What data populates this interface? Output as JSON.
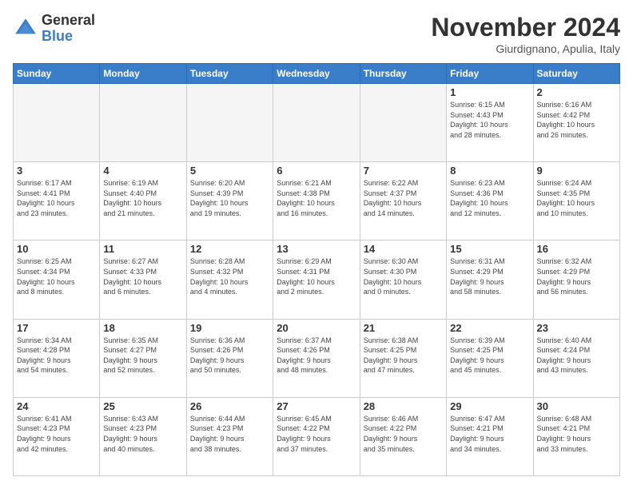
{
  "logo": {
    "general": "General",
    "blue": "Blue"
  },
  "header": {
    "month": "November 2024",
    "location": "Giurdignano, Apulia, Italy"
  },
  "weekdays": [
    "Sunday",
    "Monday",
    "Tuesday",
    "Wednesday",
    "Thursday",
    "Friday",
    "Saturday"
  ],
  "weeks": [
    [
      {
        "day": "",
        "info": ""
      },
      {
        "day": "",
        "info": ""
      },
      {
        "day": "",
        "info": ""
      },
      {
        "day": "",
        "info": ""
      },
      {
        "day": "",
        "info": ""
      },
      {
        "day": "1",
        "info": "Sunrise: 6:15 AM\nSunset: 4:43 PM\nDaylight: 10 hours\nand 28 minutes."
      },
      {
        "day": "2",
        "info": "Sunrise: 6:16 AM\nSunset: 4:42 PM\nDaylight: 10 hours\nand 26 minutes."
      }
    ],
    [
      {
        "day": "3",
        "info": "Sunrise: 6:17 AM\nSunset: 4:41 PM\nDaylight: 10 hours\nand 23 minutes."
      },
      {
        "day": "4",
        "info": "Sunrise: 6:19 AM\nSunset: 4:40 PM\nDaylight: 10 hours\nand 21 minutes."
      },
      {
        "day": "5",
        "info": "Sunrise: 6:20 AM\nSunset: 4:39 PM\nDaylight: 10 hours\nand 19 minutes."
      },
      {
        "day": "6",
        "info": "Sunrise: 6:21 AM\nSunset: 4:38 PM\nDaylight: 10 hours\nand 16 minutes."
      },
      {
        "day": "7",
        "info": "Sunrise: 6:22 AM\nSunset: 4:37 PM\nDaylight: 10 hours\nand 14 minutes."
      },
      {
        "day": "8",
        "info": "Sunrise: 6:23 AM\nSunset: 4:36 PM\nDaylight: 10 hours\nand 12 minutes."
      },
      {
        "day": "9",
        "info": "Sunrise: 6:24 AM\nSunset: 4:35 PM\nDaylight: 10 hours\nand 10 minutes."
      }
    ],
    [
      {
        "day": "10",
        "info": "Sunrise: 6:25 AM\nSunset: 4:34 PM\nDaylight: 10 hours\nand 8 minutes."
      },
      {
        "day": "11",
        "info": "Sunrise: 6:27 AM\nSunset: 4:33 PM\nDaylight: 10 hours\nand 6 minutes."
      },
      {
        "day": "12",
        "info": "Sunrise: 6:28 AM\nSunset: 4:32 PM\nDaylight: 10 hours\nand 4 minutes."
      },
      {
        "day": "13",
        "info": "Sunrise: 6:29 AM\nSunset: 4:31 PM\nDaylight: 10 hours\nand 2 minutes."
      },
      {
        "day": "14",
        "info": "Sunrise: 6:30 AM\nSunset: 4:30 PM\nDaylight: 10 hours\nand 0 minutes."
      },
      {
        "day": "15",
        "info": "Sunrise: 6:31 AM\nSunset: 4:29 PM\nDaylight: 9 hours\nand 58 minutes."
      },
      {
        "day": "16",
        "info": "Sunrise: 6:32 AM\nSunset: 4:29 PM\nDaylight: 9 hours\nand 56 minutes."
      }
    ],
    [
      {
        "day": "17",
        "info": "Sunrise: 6:34 AM\nSunset: 4:28 PM\nDaylight: 9 hours\nand 54 minutes."
      },
      {
        "day": "18",
        "info": "Sunrise: 6:35 AM\nSunset: 4:27 PM\nDaylight: 9 hours\nand 52 minutes."
      },
      {
        "day": "19",
        "info": "Sunrise: 6:36 AM\nSunset: 4:26 PM\nDaylight: 9 hours\nand 50 minutes."
      },
      {
        "day": "20",
        "info": "Sunrise: 6:37 AM\nSunset: 4:26 PM\nDaylight: 9 hours\nand 48 minutes."
      },
      {
        "day": "21",
        "info": "Sunrise: 6:38 AM\nSunset: 4:25 PM\nDaylight: 9 hours\nand 47 minutes."
      },
      {
        "day": "22",
        "info": "Sunrise: 6:39 AM\nSunset: 4:25 PM\nDaylight: 9 hours\nand 45 minutes."
      },
      {
        "day": "23",
        "info": "Sunrise: 6:40 AM\nSunset: 4:24 PM\nDaylight: 9 hours\nand 43 minutes."
      }
    ],
    [
      {
        "day": "24",
        "info": "Sunrise: 6:41 AM\nSunset: 4:23 PM\nDaylight: 9 hours\nand 42 minutes."
      },
      {
        "day": "25",
        "info": "Sunrise: 6:43 AM\nSunset: 4:23 PM\nDaylight: 9 hours\nand 40 minutes."
      },
      {
        "day": "26",
        "info": "Sunrise: 6:44 AM\nSunset: 4:23 PM\nDaylight: 9 hours\nand 38 minutes."
      },
      {
        "day": "27",
        "info": "Sunrise: 6:45 AM\nSunset: 4:22 PM\nDaylight: 9 hours\nand 37 minutes."
      },
      {
        "day": "28",
        "info": "Sunrise: 6:46 AM\nSunset: 4:22 PM\nDaylight: 9 hours\nand 35 minutes."
      },
      {
        "day": "29",
        "info": "Sunrise: 6:47 AM\nSunset: 4:21 PM\nDaylight: 9 hours\nand 34 minutes."
      },
      {
        "day": "30",
        "info": "Sunrise: 6:48 AM\nSunset: 4:21 PM\nDaylight: 9 hours\nand 33 minutes."
      }
    ]
  ]
}
